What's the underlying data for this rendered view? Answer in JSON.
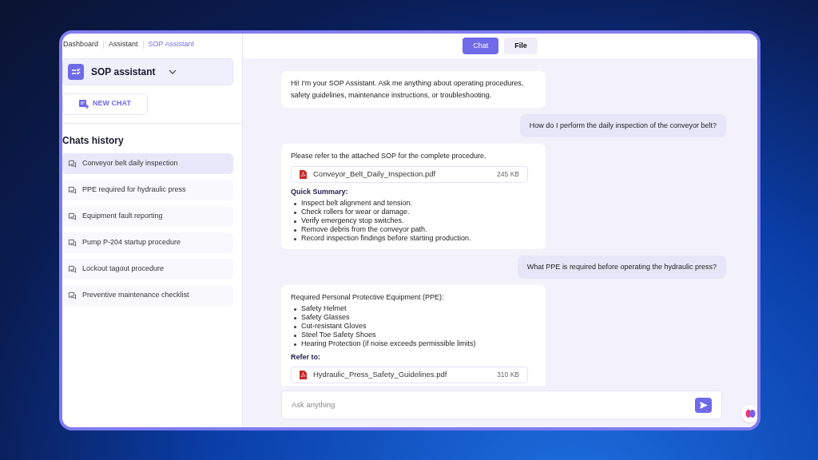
{
  "breadcrumbs": [
    {
      "label": "Dashboard",
      "selected": false
    },
    {
      "label": "Assistant",
      "selected": false
    },
    {
      "label": "SOP Assistant",
      "selected": true
    }
  ],
  "assistant_selector": {
    "label": "SOP assistant"
  },
  "new_chat_button": "NEW CHAT",
  "history": {
    "title": "Chats history",
    "items": [
      {
        "label": "Conveyor belt daily inspection",
        "selected": true
      },
      {
        "label": "PPE required for hydraulic press",
        "selected": false
      },
      {
        "label": "Equipment fault reporting",
        "selected": false
      },
      {
        "label": "Pump P-204 startup procedure",
        "selected": false
      },
      {
        "label": "Lockout tagout procedure",
        "selected": false
      },
      {
        "label": "Preventive maintenance checklist",
        "selected": false
      }
    ]
  },
  "tabs": [
    {
      "label": "Chat",
      "selected": true
    },
    {
      "label": "File",
      "selected": false
    }
  ],
  "messages": [
    {
      "kind": "bot",
      "blocks": [
        {
          "kind": "text",
          "text": "Hi! I'm your SOP Assistant. Ask me anything about operating procedures, safety guidelines, maintenance instructions, or troubleshooting."
        }
      ]
    },
    {
      "kind": "user",
      "blocks": [
        {
          "kind": "text",
          "text": "How do I perform the daily inspection of the conveyor belt?"
        }
      ]
    },
    {
      "kind": "bot",
      "blocks": [
        {
          "kind": "text",
          "text": "Please refer to the attached SOP for the complete procedure."
        },
        {
          "kind": "file",
          "name": "Conveyor_Belt_Daily_Inspection.pdf",
          "size": "245 KB"
        },
        {
          "kind": "heading",
          "text": "Quick Summary:"
        },
        {
          "kind": "list",
          "items": [
            "Inspect belt alignment and tension.",
            "Check rollers for wear or damage.",
            "Verify emergency stop switches.",
            "Remove debris from the conveyor path.",
            "Record inspection findings before starting production."
          ]
        }
      ]
    },
    {
      "kind": "user",
      "blocks": [
        {
          "kind": "text",
          "text": "What PPE is required before operating the hydraulic press?"
        }
      ]
    },
    {
      "kind": "bot",
      "blocks": [
        {
          "kind": "text",
          "text": "Required Personal Protective Equipment (PPE):"
        },
        {
          "kind": "list",
          "items": [
            "Safety Helmet",
            "Safety Glasses",
            "Cut-resistant Gloves",
            "Steel Toe Safety Shoes",
            "Hearing Protection (if noise exceeds permissible limits)"
          ]
        },
        {
          "kind": "heading",
          "text": "Refer to:"
        },
        {
          "kind": "file",
          "name": "Hydraulic_Press_Safety_Guidelines.pdf",
          "size": "310 KB"
        }
      ]
    }
  ],
  "composer": {
    "placeholder": "Ask anything"
  }
}
